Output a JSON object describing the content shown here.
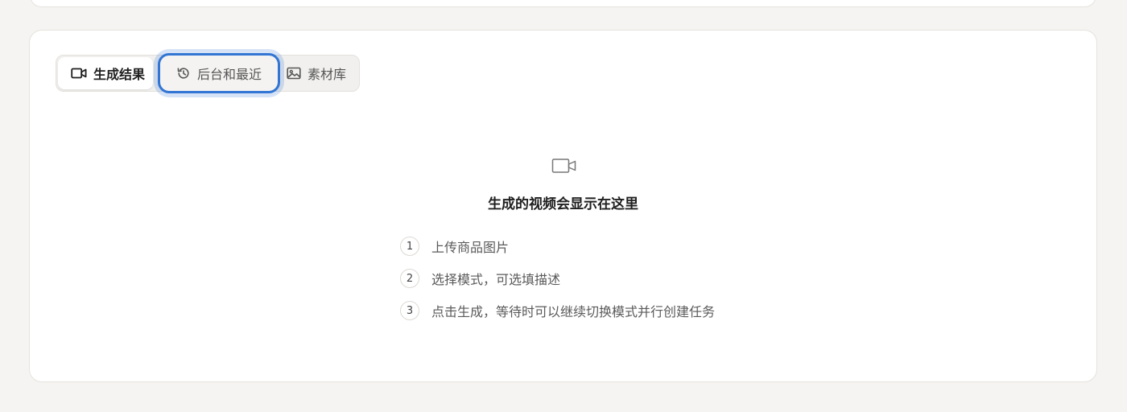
{
  "tabs": [
    {
      "label": "生成结果",
      "icon": "video-camera-icon",
      "state": "active"
    },
    {
      "label": "后台和最近",
      "icon": "history-icon",
      "state": "focused"
    },
    {
      "label": "素材库",
      "icon": "image-icon",
      "state": "inactive"
    }
  ],
  "empty_state": {
    "icon": "video-camera-icon",
    "title": "生成的视频会显示在这里",
    "steps": [
      {
        "number": "1",
        "text": "上传商品图片"
      },
      {
        "number": "2",
        "text": "选择模式，可选填描述"
      },
      {
        "number": "3",
        "text": "点击生成，等待时可以继续切换模式并行创建任务"
      }
    ]
  },
  "colors": {
    "page_background": "#f5f4f2",
    "card_background": "#ffffff",
    "focus_ring": "#3275d4"
  }
}
